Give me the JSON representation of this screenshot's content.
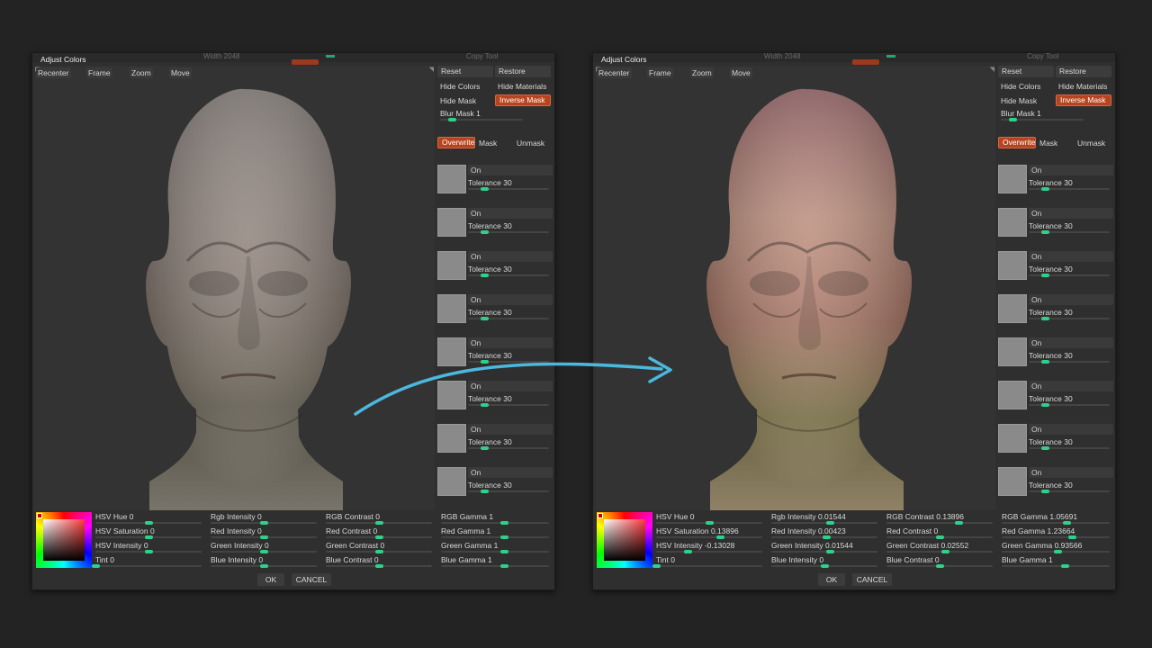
{
  "colors": {
    "accent_orange": "#b8431f",
    "slider_green": "#2fd08a",
    "arrow_blue": "#4bb8de"
  },
  "background_ui": {
    "copy_tool": "Copy Tool",
    "faint_value": "Width 2048"
  },
  "panels": [
    {
      "title": "Adjust Colors",
      "viewport_buttons": {
        "recenter": "Recenter",
        "frame": "Frame",
        "zoom": "Zoom",
        "move": "Move"
      },
      "tint": "neutral",
      "right": {
        "reset": "Reset",
        "restore": "Restore",
        "hide_colors": "Hide Colors",
        "hide_materials": "Hide Materials",
        "hide_mask": "Hide Mask",
        "inverse_mask": "Inverse Mask",
        "blur_mask": {
          "label": "Blur Mask 1",
          "value": 0.1
        },
        "overwrite": "Overwrite",
        "mask": "Mask",
        "unmask": "Unmask",
        "rows": [
          {
            "on": "On",
            "tolerance": "Tolerance 30",
            "value": 0.15
          },
          {
            "on": "On",
            "tolerance": "Tolerance 30",
            "value": 0.15
          },
          {
            "on": "On",
            "tolerance": "Tolerance 30",
            "value": 0.15
          },
          {
            "on": "On",
            "tolerance": "Tolerance 30",
            "value": 0.15
          },
          {
            "on": "On",
            "tolerance": "Tolerance 30",
            "value": 0.15
          },
          {
            "on": "On",
            "tolerance": "Tolerance 30",
            "value": 0.15
          },
          {
            "on": "On",
            "tolerance": "Tolerance 30",
            "value": 0.15
          },
          {
            "on": "On",
            "tolerance": "Tolerance 30",
            "value": 0.15
          }
        ]
      },
      "sliders": [
        [
          {
            "label": "HSV Hue 0",
            "value": 0.5
          },
          {
            "label": "HSV Saturation 0",
            "value": 0.5
          },
          {
            "label": "HSV Intensity 0",
            "value": 0.5
          },
          {
            "label": "Tint 0",
            "value": 0.0
          }
        ],
        [
          {
            "label": "Rgb Intensity 0",
            "value": 0.5
          },
          {
            "label": "Red Intensity 0",
            "value": 0.5
          },
          {
            "label": "Green Intensity 0",
            "value": 0.5
          },
          {
            "label": "Blue Intensity 0",
            "value": 0.5
          }
        ],
        [
          {
            "label": "RGB Contrast 0",
            "value": 0.5
          },
          {
            "label": "Red Contrast 0",
            "value": 0.5
          },
          {
            "label": "Green Contrast 0",
            "value": 0.5
          },
          {
            "label": "Blue Contrast 0",
            "value": 0.5
          }
        ],
        [
          {
            "label": "RGB Gamma 1",
            "value": 0.58
          },
          {
            "label": "Red Gamma 1",
            "value": 0.58
          },
          {
            "label": "Green Gamma 1",
            "value": 0.58
          },
          {
            "label": "Blue Gamma 1",
            "value": 0.58
          }
        ]
      ],
      "ok": "OK",
      "cancel": "CANCEL"
    },
    {
      "title": "Adjust Colors",
      "viewport_buttons": {
        "recenter": "Recenter",
        "frame": "Frame",
        "zoom": "Zoom",
        "move": "Move"
      },
      "tint": "colored",
      "right": {
        "reset": "Reset",
        "restore": "Restore",
        "hide_colors": "Hide Colors",
        "hide_materials": "Hide Materials",
        "hide_mask": "Hide Mask",
        "inverse_mask": "Inverse Mask",
        "blur_mask": {
          "label": "Blur Mask 1",
          "value": 0.1
        },
        "overwrite": "Overwrite",
        "mask": "Mask",
        "unmask": "Unmask",
        "rows": [
          {
            "on": "On",
            "tolerance": "Tolerance 30",
            "value": 0.15
          },
          {
            "on": "On",
            "tolerance": "Tolerance 30",
            "value": 0.15
          },
          {
            "on": "On",
            "tolerance": "Tolerance 30",
            "value": 0.15
          },
          {
            "on": "On",
            "tolerance": "Tolerance 30",
            "value": 0.15
          },
          {
            "on": "On",
            "tolerance": "Tolerance 30",
            "value": 0.15
          },
          {
            "on": "On",
            "tolerance": "Tolerance 30",
            "value": 0.15
          },
          {
            "on": "On",
            "tolerance": "Tolerance 30",
            "value": 0.15
          },
          {
            "on": "On",
            "tolerance": "Tolerance 30",
            "value": 0.15
          }
        ]
      },
      "sliders": [
        [
          {
            "label": "HSV Hue 0",
            "value": 0.5
          },
          {
            "label": "HSV Saturation 0.13896",
            "value": 0.6
          },
          {
            "label": "HSV Intensity -0.13028",
            "value": 0.3
          },
          {
            "label": "Tint 0",
            "value": 0.0
          }
        ],
        [
          {
            "label": "Rgb Intensity 0.01544",
            "value": 0.55
          },
          {
            "label": "Red Intensity 0.00423",
            "value": 0.52
          },
          {
            "label": "Green Intensity 0.01544",
            "value": 0.55
          },
          {
            "label": "Blue Intensity 0",
            "value": 0.5
          }
        ],
        [
          {
            "label": "RGB Contrast 0.13896",
            "value": 0.68
          },
          {
            "label": "Red Contrast 0",
            "value": 0.5
          },
          {
            "label": "Green Contrast 0.02552",
            "value": 0.55
          },
          {
            "label": "Blue Contrast 0",
            "value": 0.5
          }
        ],
        [
          {
            "label": "RGB Gamma 1.05691",
            "value": 0.6
          },
          {
            "label": "Red Gamma 1.23664",
            "value": 0.65
          },
          {
            "label": "Green Gamma 0.93566",
            "value": 0.52
          },
          {
            "label": "Blue Gamma 1",
            "value": 0.58
          }
        ]
      ],
      "ok": "OK",
      "cancel": "CANCEL"
    }
  ]
}
